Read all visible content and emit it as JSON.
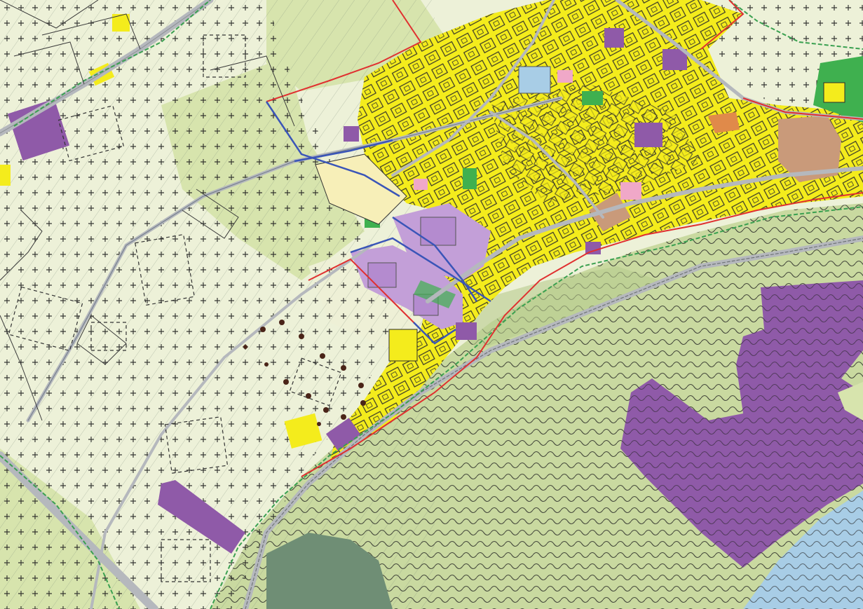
{
  "map": {
    "kind": "zoning-land-use-plan",
    "colors": {
      "agricultural": "#edf1d8",
      "meadow_green": "#d7e4ad",
      "forest_green": "#c9d9a0",
      "residential_yellow": "#f4ec1c",
      "building_outline": "#2b2b2b",
      "public_purple": "#8f5aa8",
      "industrial_lilac": "#c39fd8",
      "commercial_brown": "#c99a7a",
      "pink": "#f0a8c8",
      "park_green": "#3fb04f",
      "water_blue": "#a8cde6",
      "road_grey": "#b5b8bd",
      "boundary_red": "#e03030",
      "boundary_blue": "#3a55b8",
      "stream_green": "#3aa050",
      "dark_green": "#6f8e75"
    }
  }
}
